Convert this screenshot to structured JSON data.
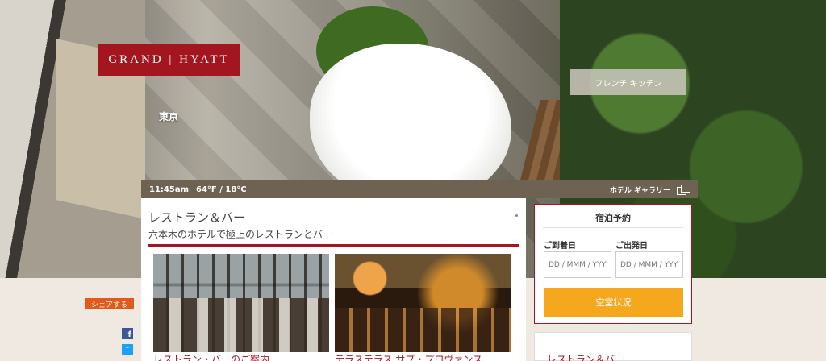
{
  "brand": {
    "logo_text": "GRAND | HYATT",
    "city": "東京",
    "color": "#a4161f"
  },
  "hero": {
    "restaurant_button": "フレンチ キッチン"
  },
  "infobar": {
    "time": "11:45am",
    "weather": "64°F / 18°C",
    "gallery_label": "ホテル ギャラリー"
  },
  "main": {
    "title": "レストラン＆バー",
    "subtitle": "六本木のホテルで極上のレストランとバー",
    "cards": [
      {
        "label": "レストラン・バーのご案内"
      },
      {
        "label": "テラステラス サブ・プロヴァンス"
      }
    ]
  },
  "booking": {
    "title": "宿泊予約",
    "checkin_label": "ご到着日",
    "checkout_label": "ご出発日",
    "date_placeholder": "DD / MMM / YYYY",
    "availability_button": "空室状況",
    "button_color": "#f5a71e"
  },
  "sidebar_card": {
    "title": "レストラン＆バー"
  },
  "share": {
    "label": "シェアする",
    "facebook": "f",
    "twitter": "t"
  }
}
